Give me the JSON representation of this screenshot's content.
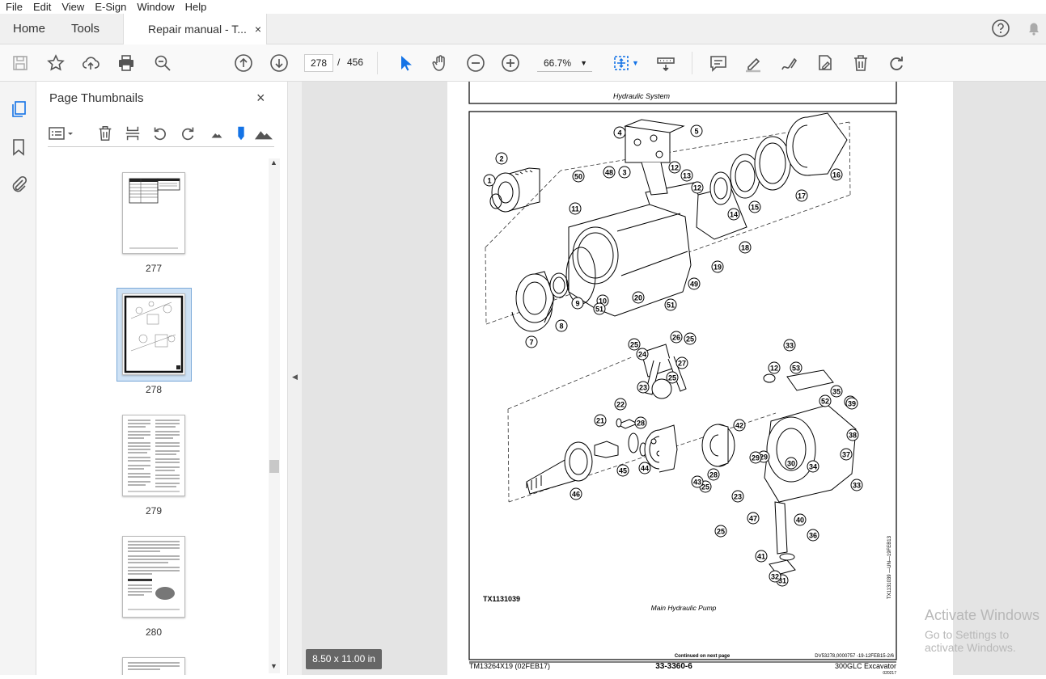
{
  "menu": [
    "File",
    "Edit",
    "View",
    "E-Sign",
    "Window",
    "Help"
  ],
  "tabs": {
    "home": "Home",
    "tools": "Tools",
    "doc": "Repair manual - T...",
    "close": "×"
  },
  "toolbar": {
    "page_current": "278",
    "page_sep": "/",
    "page_total": "456",
    "zoom": "66.7%"
  },
  "panel": {
    "title": "Page Thumbnails",
    "close": "×"
  },
  "thumbnails": [
    {
      "num": "277",
      "selected": false
    },
    {
      "num": "278",
      "selected": true
    },
    {
      "num": "279",
      "selected": false
    },
    {
      "num": "280",
      "selected": false
    }
  ],
  "document": {
    "header_caption": "Hydraulic System",
    "figure_id": "TX1131039",
    "figure_caption": "Main Hydraulic Pump",
    "side_code": "TX1131039 —UN—19FEB13",
    "continued": "Continued on next page",
    "ref_code": "DV53278,0000757 -19-12FEB15-2/6",
    "footer_left": "TM13264X19 (02FEB17)",
    "footer_center": "33-3360-6",
    "footer_right": "300GLC Excavator",
    "footer_date": "020217",
    "callouts": [
      "1",
      "2",
      "3",
      "4",
      "5",
      "7",
      "8",
      "9",
      "10",
      "11",
      "12",
      "12",
      "13",
      "14",
      "15",
      "16",
      "17",
      "18",
      "19",
      "20",
      "21",
      "22",
      "23",
      "23",
      "24",
      "25",
      "25",
      "25",
      "25",
      "25",
      "26",
      "27",
      "28",
      "28",
      "29",
      "29",
      "30",
      "31",
      "32",
      "33",
      "33",
      "34",
      "34",
      "35",
      "36",
      "37",
      "38",
      "39",
      "40",
      "41",
      "42",
      "43",
      "44",
      "45",
      "46",
      "47",
      "48",
      "49",
      "50",
      "51",
      "51",
      "52",
      "53",
      "12"
    ]
  },
  "status": {
    "page_size": "8.50 x 11.00 in"
  },
  "watermark": {
    "line1": "Activate Windows",
    "line2": "Go to Settings to activate Windows."
  },
  "colors": {
    "accent": "#1473e6",
    "chrome": "#f0f0f0"
  }
}
